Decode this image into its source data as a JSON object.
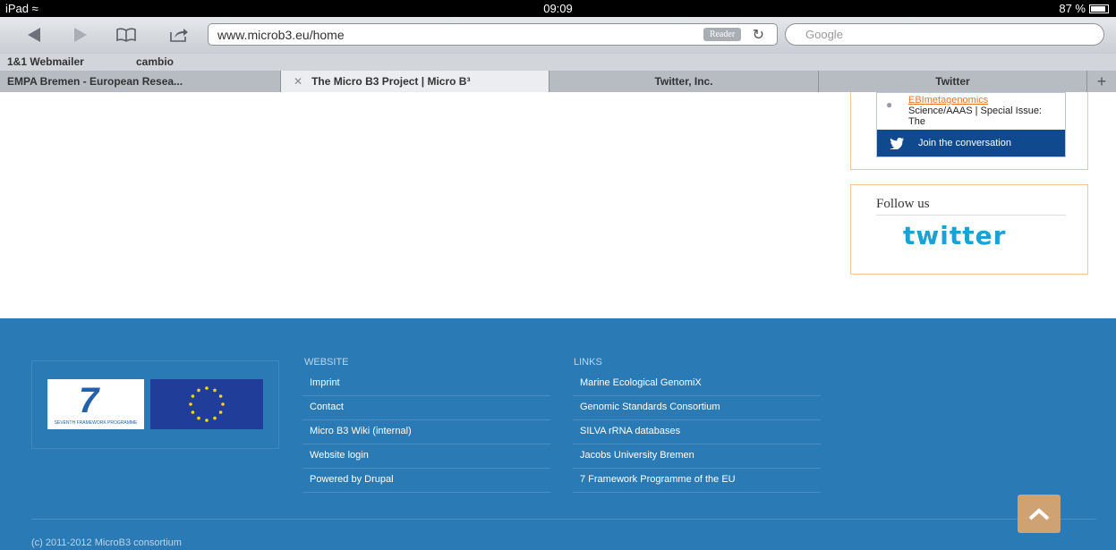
{
  "status_bar": {
    "device": "iPad",
    "time": "09:09",
    "battery": "87 %",
    "battery_level": 0.87
  },
  "toolbar": {
    "url": "www.microb3.eu/home",
    "reader_label": "Reader",
    "search_placeholder": "Google"
  },
  "bookmarks": [
    {
      "label": "1&1 Webmailer"
    },
    {
      "label": "cambio"
    }
  ],
  "tabs": [
    {
      "label": "EMPA Bremen - European Resea..."
    },
    {
      "label": "The Micro B3 Project | Micro B³"
    },
    {
      "label": "Twitter, Inc."
    },
    {
      "label": "Twitter"
    }
  ],
  "twitter_widget": {
    "link": "EBImetagenomics",
    "text": "Science/AAAS | Special Issue: The",
    "join": "Join the conversation"
  },
  "follow": {
    "title": "Follow us",
    "logo": "twitter"
  },
  "footer": {
    "fp7_caption": "SEVENTH FRAMEWORK PROGRAMME",
    "website_heading": "WEBSITE",
    "website_links": [
      "Imprint",
      "Contact",
      "Micro B3 Wiki (internal)",
      "Website login",
      "Powered by Drupal"
    ],
    "links_heading": "LINKS",
    "links": [
      "Marine Ecological GenomiX",
      "Genomic Standards Consortium",
      "SILVA rRNA databases",
      "Jacobs University Bremen",
      "7 Framework Programme of the EU"
    ],
    "copyright": "(c) 2011-2012 MicroB3 consortium"
  }
}
